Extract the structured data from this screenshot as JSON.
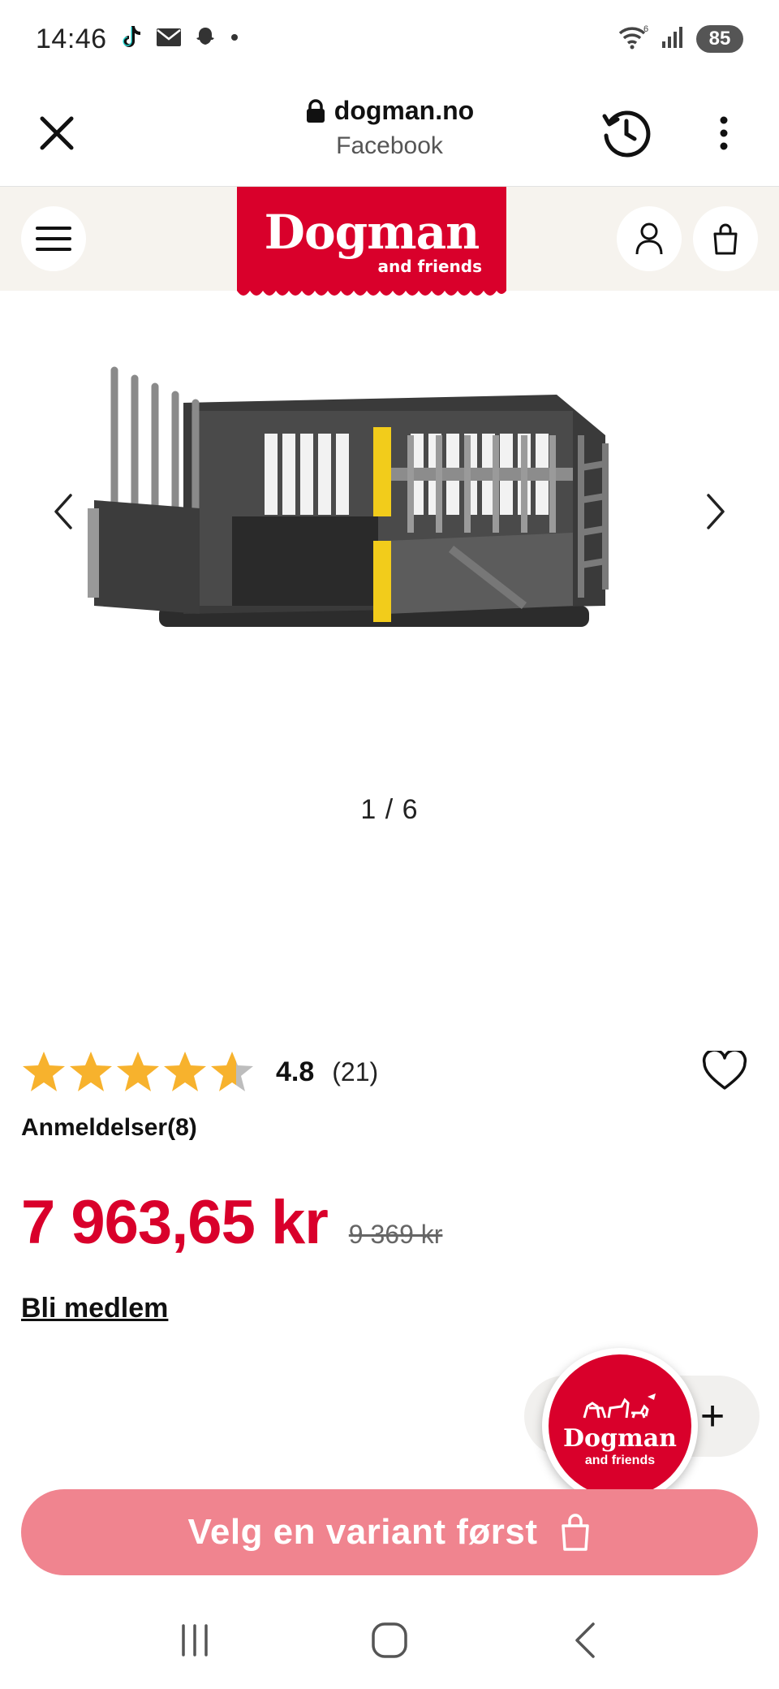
{
  "status_bar": {
    "time": "14:46",
    "battery": "85",
    "notification_icons": [
      "tiktok-icon",
      "mail-icon",
      "snapchat-icon",
      "dot-icon"
    ],
    "system_icons": [
      "wifi-icon",
      "signal-icon",
      "battery-icon"
    ]
  },
  "browser": {
    "domain": "dogman.no",
    "source": "Facebook"
  },
  "site": {
    "logo_title": "Dogman",
    "logo_subtitle": "and friends",
    "brand_color": "#d9002b",
    "header_bg": "#f6f3ee"
  },
  "gallery": {
    "pager": "1 / 6",
    "image_subject": "double dog crate with yellow divider"
  },
  "product": {
    "rating_value": "4.8",
    "rating_count": "(21)",
    "rating_stars": 4.8,
    "reviews_link": "Anmeldelser(8)",
    "price": "7 963,65 kr",
    "old_price": "9 369 kr",
    "member_link": "Bli medlem"
  },
  "quantity": {
    "plus_label": "+"
  },
  "float_badge": {
    "title": "Dogman",
    "subtitle": "and friends"
  },
  "cta": {
    "label": "Velg en variant først",
    "color": "#f0848f"
  }
}
